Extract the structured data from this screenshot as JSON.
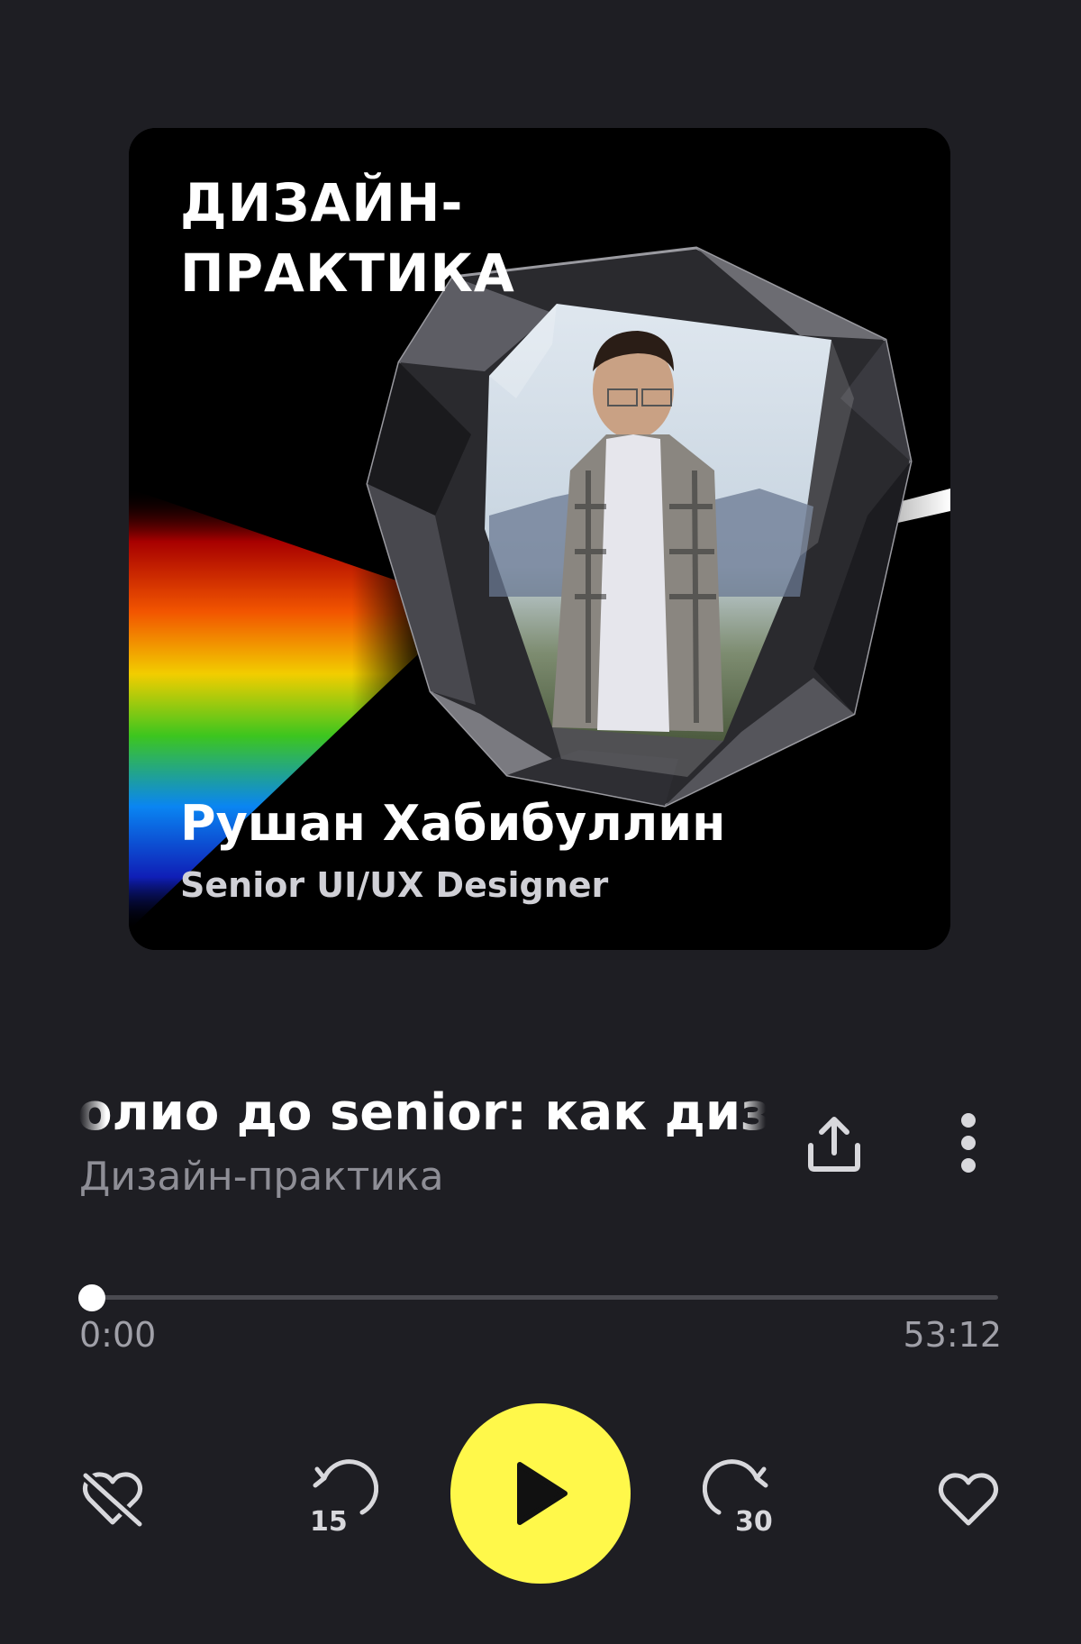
{
  "cover": {
    "title": "ДИЗАЙН-\nПРАКТИКА",
    "guest_name": "Рушан Хабибуллин",
    "guest_role": "Senior UI/UX Designer"
  },
  "episode": {
    "title": "ролио до senior: как дизай",
    "podcast": "Дизайн-практика"
  },
  "progress": {
    "current": "0:00",
    "total": "53:12",
    "fraction": 0.0
  },
  "controls": {
    "rewind_seconds": "15",
    "forward_seconds": "30"
  },
  "colors": {
    "background": "#1e1e23",
    "accent": "#fff84a",
    "secondary_text": "#8e8e96"
  },
  "icons": [
    "share-icon",
    "more-vertical-icon",
    "dislike-icon",
    "rewind-15-icon",
    "play-icon",
    "forward-30-icon",
    "heart-icon"
  ]
}
